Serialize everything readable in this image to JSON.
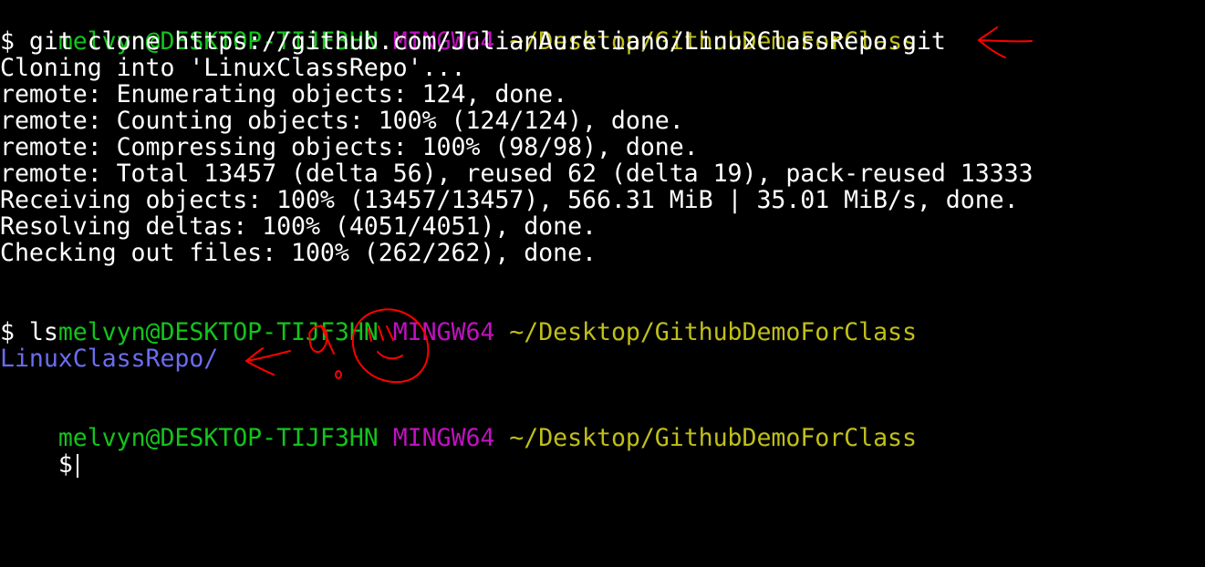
{
  "prompts": [
    {
      "user": "melvyn@DESKTOP-TIJF3HN",
      "host": "MINGW64",
      "path": "~/Desktop/GithubDemoForClass"
    },
    {
      "user": "melvyn@DESKTOP-TIJF3HN",
      "host": "MINGW64",
      "path": "~/Desktop/GithubDemoForClass"
    },
    {
      "user": "melvyn@DESKTOP-TIJF3HN",
      "host": "MINGW64",
      "path": "~/Desktop/GithubDemoForClass"
    }
  ],
  "commands": [
    "$ git clone https://github.com/JulianAureliano/LinuxClassRepo.git",
    "$ ls",
    "$"
  ],
  "output": {
    "clone": [
      "Cloning into 'LinuxClassRepo'...",
      "remote: Enumerating objects: 124, done.",
      "remote: Counting objects: 100% (124/124), done.",
      "remote: Compressing objects: 100% (98/98), done.",
      "remote: Total 13457 (delta 56), reused 62 (delta 19), pack-reused 13333",
      "Receiving objects: 100% (13457/13457), 566.31 MiB | 35.01 MiB/s, done.",
      "Resolving deltas: 100% (4051/4051), done.",
      "Checking out files: 100% (262/262), done."
    ],
    "ls": [
      "LinuxClassRepo/"
    ]
  },
  "colors": {
    "background": "#000000",
    "user": "#13c41c",
    "host": "#bf12bf",
    "path": "#c0bf1a",
    "text": "#ffffff",
    "directory": "#6c6cf0",
    "annotation": "#ff0000"
  },
  "annotations": [
    "red-arrow-icon",
    "red-arrow-icon",
    "hand-drawn-exclamation-icon",
    "hand-drawn-smiley-icon"
  ]
}
